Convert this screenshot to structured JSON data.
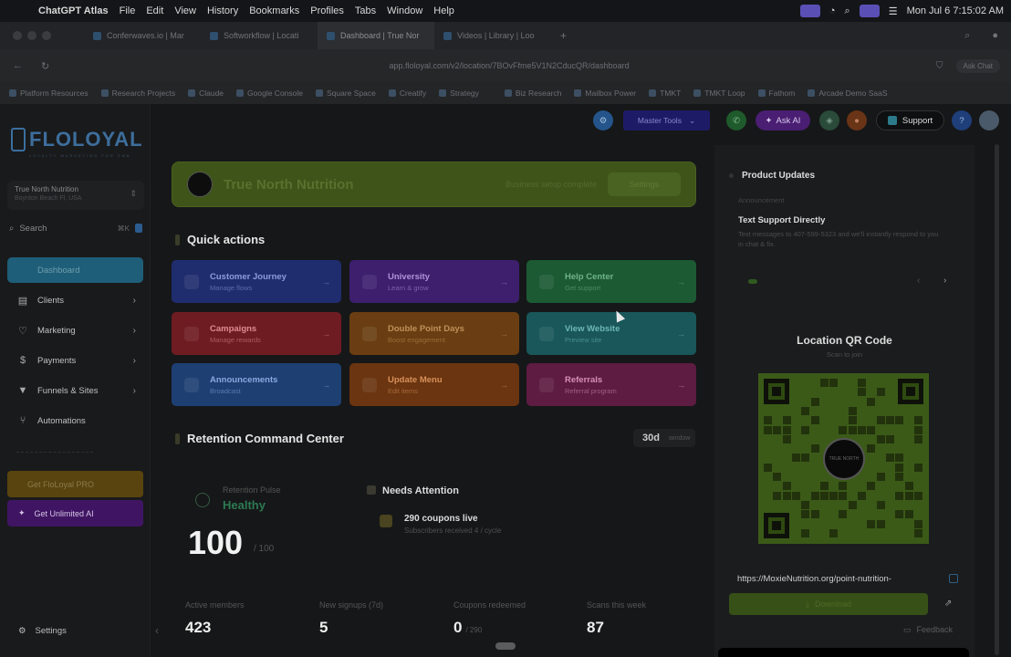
{
  "menubar": {
    "app": "ChatGPT Atlas",
    "items": [
      "File",
      "Edit",
      "View",
      "History",
      "Bookmarks",
      "Profiles",
      "Tabs",
      "Window",
      "Help"
    ],
    "clock": "Mon Jul 6  7:15:02 AM"
  },
  "tabs": [
    "Conferwaves.io | Mar",
    "Softworkflow | Locati",
    "Dashboard | True Nor",
    "Videos | Library | Loo"
  ],
  "address": {
    "url": "app.floloyal.com/v2/location/7BOvFfme5V1N2CducQR/dashboard",
    "ask_chat": "Ask Chat"
  },
  "bookmarks": [
    "Platform Resources",
    "Research Projects",
    "Claude",
    "Google Console",
    "Square Space",
    "Creatify",
    "Strategy",
    "Biz Research",
    "Mailbox Power",
    "TMKT",
    "TMKT Loop",
    "Fathom",
    "Arcade Demo SaaS"
  ],
  "sidebar": {
    "logo": "FLOLOYAL",
    "logo_tag": "LOYALTY  MARKETING  FOR  SMB",
    "location_name": "True North Nutrition",
    "location_sub": "Boynton Beach Fl, USA",
    "search": "Search",
    "search_kbd": "⌘K",
    "items": [
      {
        "label": "Dashboard"
      },
      {
        "label": "Clients"
      },
      {
        "label": "Marketing"
      },
      {
        "label": "Payments"
      },
      {
        "label": "Funnels & Sites"
      },
      {
        "label": "Automations"
      }
    ],
    "promo_gold": "Get FloLoyal PRO",
    "promo_purple": "Get Unlimited AI",
    "settings": "Settings"
  },
  "toolbar": {
    "master_tools": "Master Tools",
    "ask_ai": "Ask AI",
    "support": "Support",
    "help": "?"
  },
  "banner": {
    "name": "True North Nutrition",
    "sub": "Business setup complete",
    "button": "Settings"
  },
  "quick_actions": {
    "title": "Quick actions",
    "items": [
      {
        "title": "Customer Journey",
        "sub": "Manage flows"
      },
      {
        "title": "University",
        "sub": "Learn & grow"
      },
      {
        "title": "Help Center",
        "sub": "Get support"
      },
      {
        "title": "Campaigns",
        "sub": "Manage rewards"
      },
      {
        "title": "Double Point Days",
        "sub": "Boost engagement"
      },
      {
        "title": "View Website",
        "sub": "Preview site"
      },
      {
        "title": "Announcements",
        "sub": "Broadcast"
      },
      {
        "title": "Update Menu",
        "sub": "Edit items"
      },
      {
        "title": "Referrals",
        "sub": "Referral program"
      }
    ]
  },
  "retention": {
    "title": "Retention Command Center",
    "range": "30d",
    "range_sub": "window",
    "pulse_label": "Retention Pulse",
    "pulse_value": "Healthy",
    "score": "100",
    "score_denominator": "/ 100",
    "needs_title": "Needs Attention",
    "coupons_title": "290 coupons live",
    "coupons_sub": "Subscribers received 4 / cycle",
    "stats": [
      {
        "label": "Active members",
        "value": "423",
        "sub": ""
      },
      {
        "label": "New signups (7d)",
        "value": "5",
        "sub": ""
      },
      {
        "label": "Coupons redeemed",
        "value": "0",
        "sub": "/ 290"
      },
      {
        "label": "Scans this week",
        "value": "87",
        "sub": ""
      }
    ]
  },
  "product_updates": {
    "title": "Product Updates",
    "badge": "Announcement",
    "headline": "Text Support Directly",
    "body": "Text messages to 407-599-5323 and we'll instantly respond to you in chat & fix."
  },
  "qr": {
    "title": "Location QR Code",
    "sub": "Scan to join",
    "center_text": "TRUE NORTH",
    "url": "https://MoxieNutrition.org/point-nutrition-",
    "download": "Download"
  },
  "feedback": "Feedback",
  "colors": {
    "accent_blue": "#1e5e78",
    "banner_green": "#3e5419",
    "qa_colors": [
      "#1f2d6e",
      "#3d1f6e",
      "#1c5a34",
      "#6e1c22",
      "#6a3e12",
      "#19575a",
      "#1e3f72",
      "#6a3510",
      "#5e1c42"
    ]
  }
}
